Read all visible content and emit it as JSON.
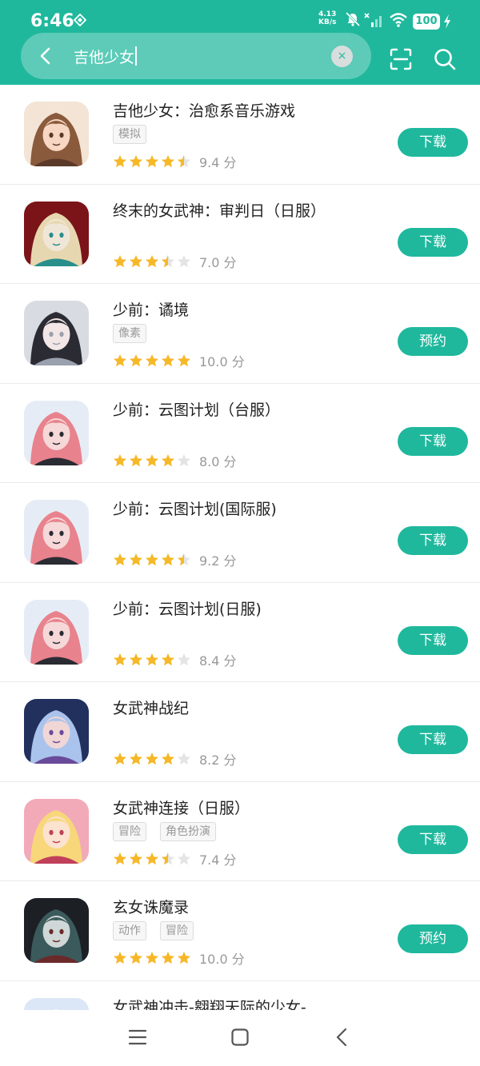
{
  "status_bar": {
    "time": "6:46",
    "net_speed_value": "4.13",
    "net_speed_unit": "KB/s",
    "battery": "100"
  },
  "search": {
    "query": "吉他少女",
    "clear_symbol": "×"
  },
  "colors": {
    "brand": "#1fb89d",
    "star": "#f5b828",
    "star_empty": "#e4e4e4"
  },
  "results": [
    {
      "name": "吉他少女：治愈系音乐游戏",
      "tags": [
        "模拟"
      ],
      "rating": 4.5,
      "score": "9.4 分",
      "action": "下载"
    },
    {
      "name": "终末的女武神：审判日（日服）",
      "tags": [],
      "rating": 3.5,
      "score": "7.0 分",
      "action": "下载"
    },
    {
      "name": "少前：谲境",
      "tags": [
        "像素"
      ],
      "rating": 5,
      "score": "10.0 分",
      "action": "预约"
    },
    {
      "name": "少前：云图计划（台服）",
      "tags": [],
      "rating": 4,
      "score": "8.0 分",
      "action": "下载"
    },
    {
      "name": "少前：云图计划(国际服)",
      "tags": [],
      "rating": 4.5,
      "score": "9.2 分",
      "action": "下载"
    },
    {
      "name": "少前：云图计划(日服)",
      "tags": [],
      "rating": 4,
      "score": "8.4 分",
      "action": "下载"
    },
    {
      "name": "女武神战纪",
      "tags": [],
      "rating": 4,
      "score": "8.2 分",
      "action": "下载"
    },
    {
      "name": "女武神连接（日服）",
      "tags": [
        "冒险",
        "角色扮演"
      ],
      "rating": 3.5,
      "score": "7.4 分",
      "action": "下载"
    },
    {
      "name": "玄女诛魔录",
      "tags": [
        "动作",
        "冒险"
      ],
      "rating": 5,
      "score": "10.0 分",
      "action": "预约"
    },
    {
      "name": "女武神冲击-翱翔天际的少女-",
      "tags": [],
      "rating": 0,
      "score": "",
      "action": ""
    }
  ]
}
